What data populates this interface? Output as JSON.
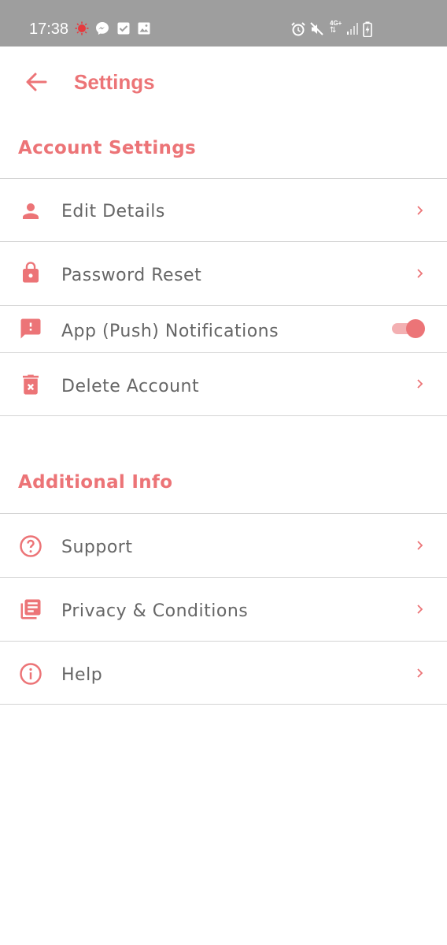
{
  "theme": {
    "accent": "#ec7477",
    "text": "#666666",
    "statusbar_bg": "#9e9e9e"
  },
  "status_bar": {
    "time": "17:38",
    "left_icons": [
      "notification-dot-icon",
      "messenger-icon",
      "checkbox-icon",
      "image-icon"
    ],
    "right_icons": [
      "alarm-icon",
      "mute-icon",
      "network-4g-icon",
      "signal-icon",
      "battery-charging-icon"
    ],
    "network_label": "4G+"
  },
  "header": {
    "title": "Settings",
    "back_icon": "arrow-back-icon"
  },
  "sections": {
    "account": {
      "title": "Account Settings",
      "items": [
        {
          "label": "Edit Details",
          "icon": "person-icon",
          "control": "chevron"
        },
        {
          "label": "Password Reset",
          "icon": "lock-icon",
          "control": "chevron"
        },
        {
          "label": "App (Push) Notifications",
          "icon": "feedback-icon",
          "control": "toggle",
          "toggle_on": true
        },
        {
          "label": "Delete Account",
          "icon": "trash-icon",
          "control": "chevron"
        }
      ]
    },
    "additional": {
      "title": "Additional Info",
      "items": [
        {
          "label": "Support",
          "icon": "help-circle-icon",
          "control": "chevron"
        },
        {
          "label": "Privacy & Conditions",
          "icon": "library-books-icon",
          "control": "chevron"
        },
        {
          "label": "Help",
          "icon": "info-icon",
          "control": "chevron"
        }
      ]
    }
  }
}
